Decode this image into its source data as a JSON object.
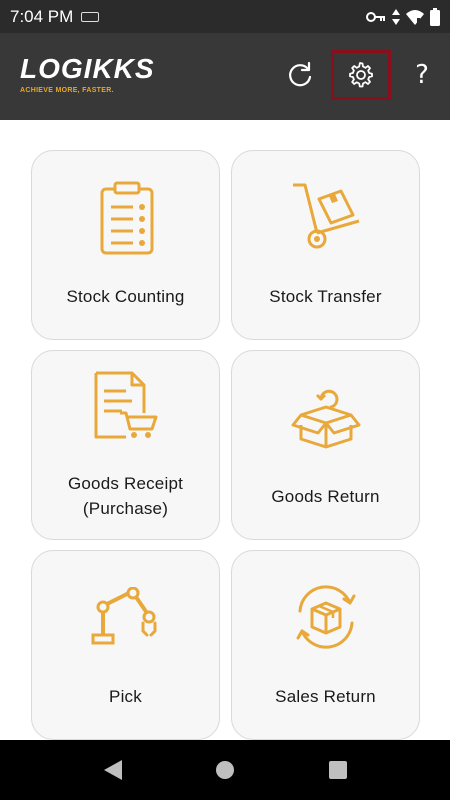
{
  "status_bar": {
    "time": "7:04 PM",
    "icons": [
      "cast-icon",
      "key-icon",
      "data-arrows-icon",
      "wifi-icon",
      "battery-icon"
    ]
  },
  "header": {
    "logo_text": "LOGIKKS",
    "logo_tagline": "ACHIEVE MORE, FASTER.",
    "refresh_icon": "refresh-icon",
    "settings_icon": "gear-icon",
    "help_label": "?"
  },
  "tiles": [
    {
      "label": "Stock Counting",
      "icon": "clipboard-checklist-icon"
    },
    {
      "label": "Stock Transfer",
      "icon": "hand-truck-box-icon"
    },
    {
      "label_line1": "Goods Receipt",
      "label_line2": "(Purchase)",
      "icon": "document-cart-icon"
    },
    {
      "label": "Goods Return",
      "icon": "open-box-return-icon"
    },
    {
      "label": "Pick",
      "icon": "robot-arm-icon"
    },
    {
      "label": "Sales Return",
      "icon": "box-cycle-arrows-icon"
    }
  ],
  "colors": {
    "accent": "#e8a83a",
    "header_bg": "#383838",
    "status_bg": "#2b2b2b",
    "highlight_border": "#8a0f1c"
  }
}
